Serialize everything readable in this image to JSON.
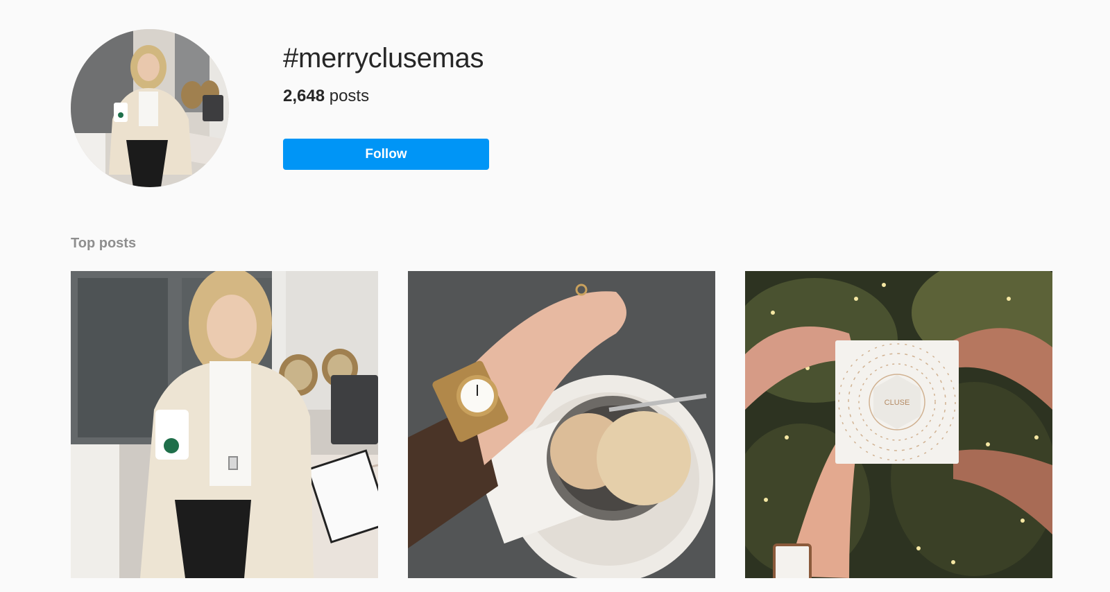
{
  "header": {
    "hashtag": "#merryclusemas",
    "post_count": "2,648",
    "post_count_label": "posts",
    "follow_label": "Follow",
    "follow_color": "#0095f6"
  },
  "top_posts": {
    "label": "Top posts",
    "items": [
      {
        "alt": "photo-woman-cafe-coffee"
      },
      {
        "alt": "photo-wrist-watch-ice-cream"
      },
      {
        "alt": "photo-gift-box-christmas-tree"
      }
    ],
    "gift_box_brand": "CLUSE"
  }
}
